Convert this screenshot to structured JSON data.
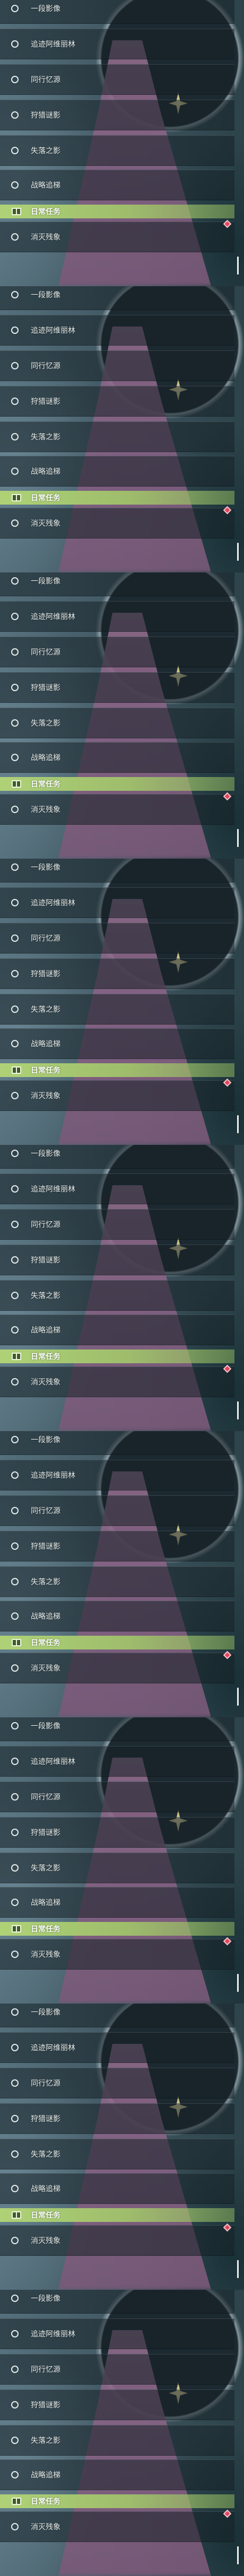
{
  "icons": {
    "quest_status": "circle-outline-icon",
    "daily_section": "daily-task-book-icon",
    "alert": "red-diamond-alert-icon"
  },
  "colors": {
    "daily_header_green": "#b2d476",
    "alert_red": "#e2465b",
    "label_text": "#e9eeec",
    "scrollbar": "#eef2f1"
  },
  "panels": [
    {
      "quests": [
        {
          "label": "一段影像"
        },
        {
          "label": "追迹阿维丽林"
        },
        {
          "label": "同行忆源"
        },
        {
          "label": "狩猎谜影"
        },
        {
          "label": "失落之影"
        },
        {
          "label": "战略追梯"
        }
      ],
      "daily_section": {
        "title": "日常任务"
      },
      "daily_quests": [
        {
          "label": "消灭残象"
        }
      ]
    },
    {
      "quests": [
        {
          "label": "一段影像"
        },
        {
          "label": "追迹阿维丽林"
        },
        {
          "label": "同行忆源"
        },
        {
          "label": "狩猎谜影"
        },
        {
          "label": "失落之影"
        },
        {
          "label": "战略追梯"
        }
      ],
      "daily_section": {
        "title": "日常任务"
      },
      "daily_quests": [
        {
          "label": "消灭残象"
        }
      ]
    },
    {
      "quests": [
        {
          "label": "一段影像"
        },
        {
          "label": "追迹阿维丽林"
        },
        {
          "label": "同行忆源"
        },
        {
          "label": "狩猎谜影"
        },
        {
          "label": "失落之影"
        },
        {
          "label": "战略追梯"
        }
      ],
      "daily_section": {
        "title": "日常任务"
      },
      "daily_quests": [
        {
          "label": "消灭残象"
        }
      ]
    },
    {
      "quests": [
        {
          "label": "一段影像"
        },
        {
          "label": "追迹阿维丽林"
        },
        {
          "label": "同行忆源"
        },
        {
          "label": "狩猎谜影"
        },
        {
          "label": "失落之影"
        },
        {
          "label": "战略追梯"
        }
      ],
      "daily_section": {
        "title": "日常任务"
      },
      "daily_quests": [
        {
          "label": "消灭残象"
        }
      ]
    },
    {
      "quests": [
        {
          "label": "一段影像"
        },
        {
          "label": "追迹阿维丽林"
        },
        {
          "label": "同行忆源"
        },
        {
          "label": "狩猎谜影"
        },
        {
          "label": "失落之影"
        },
        {
          "label": "战略追梯"
        }
      ],
      "daily_section": {
        "title": "日常任务"
      },
      "daily_quests": [
        {
          "label": "消灭残象"
        }
      ]
    },
    {
      "quests": [
        {
          "label": "一段影像"
        },
        {
          "label": "追迹阿维丽林"
        },
        {
          "label": "同行忆源"
        },
        {
          "label": "狩猎谜影"
        },
        {
          "label": "失落之影"
        },
        {
          "label": "战略追梯"
        }
      ],
      "daily_section": {
        "title": "日常任务"
      },
      "daily_quests": [
        {
          "label": "消灭残象"
        }
      ]
    },
    {
      "quests": [
        {
          "label": "一段影像"
        },
        {
          "label": "追迹阿维丽林"
        },
        {
          "label": "同行忆源"
        },
        {
          "label": "狩猎谜影"
        },
        {
          "label": "失落之影"
        },
        {
          "label": "战略追梯"
        }
      ],
      "daily_section": {
        "title": "日常任务"
      },
      "daily_quests": [
        {
          "label": "消灭残象"
        }
      ]
    },
    {
      "quests": [
        {
          "label": "一段影像"
        },
        {
          "label": "追迹阿维丽林"
        },
        {
          "label": "同行忆源"
        },
        {
          "label": "狩猎谜影"
        },
        {
          "label": "失落之影"
        },
        {
          "label": "战略追梯"
        }
      ],
      "daily_section": {
        "title": "日常任务"
      },
      "daily_quests": [
        {
          "label": "消灭残象"
        }
      ]
    },
    {
      "quests": [
        {
          "label": "一段影像"
        },
        {
          "label": "追迹阿维丽林"
        },
        {
          "label": "同行忆源"
        },
        {
          "label": "狩猎谜影"
        },
        {
          "label": "失落之影"
        },
        {
          "label": "战略追梯"
        }
      ],
      "daily_section": {
        "title": "日常任务"
      },
      "daily_quests": [
        {
          "label": "消灭残象"
        }
      ]
    }
  ]
}
